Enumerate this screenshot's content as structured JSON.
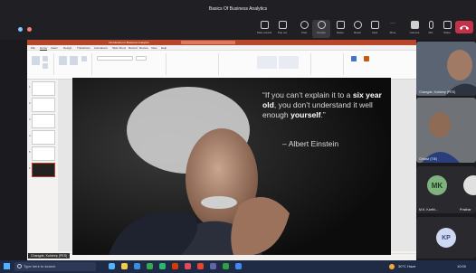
{
  "window_title": "Basics Of Business Analytics",
  "toolbar": {
    "buttons": [
      {
        "label": "Take control",
        "icon": "take-control-icon"
      },
      {
        "label": "Pop out",
        "icon": "pop-out-icon"
      },
      {
        "label": "Chat",
        "icon": "chat-icon"
      },
      {
        "label": "People",
        "icon": "people-icon"
      },
      {
        "label": "Raise",
        "icon": "raise-hand-icon"
      },
      {
        "label": "React",
        "icon": "react-icon"
      },
      {
        "label": "View",
        "icon": "view-icon"
      },
      {
        "label": "More",
        "icon": "more-icon"
      },
      {
        "label": "Camera",
        "icon": "camera-icon"
      },
      {
        "label": "Mic",
        "icon": "mic-icon"
      },
      {
        "label": "Share",
        "icon": "share-icon"
      }
    ]
  },
  "ppt": {
    "title": "Introduction to Business Analytics",
    "menu": [
      "File",
      "Home",
      "Insert",
      "Design",
      "Transitions",
      "Animations",
      "Slide Show",
      "Record",
      "Review",
      "View",
      "Help"
    ]
  },
  "slide": {
    "quote_part1": "“If you can’t explain it to a ",
    "quote_bold1": "six year old",
    "quote_part2": ", you don’t understand it well enough ",
    "quote_bold2": "yourself",
    "quote_part3": ".”",
    "author": "– Albert Einstein"
  },
  "share_name": "Changde, Kuldeep (PES)",
  "participants": [
    {
      "name": "Changde, Kuldeep (PES)",
      "type": "video"
    },
    {
      "name": "Chhavi (TIE)",
      "type": "video"
    },
    {
      "name": "M.K. Karthi...",
      "type": "avatar",
      "initials": "MK",
      "color": "#7fb27f"
    },
    {
      "name": "Prakhar",
      "type": "avatar",
      "initials": "KP",
      "color": "#cfd8f2"
    }
  ],
  "taskbar": {
    "search_placeholder": "Type here to search",
    "weather": "30°C Haze",
    "time": "10:00"
  }
}
